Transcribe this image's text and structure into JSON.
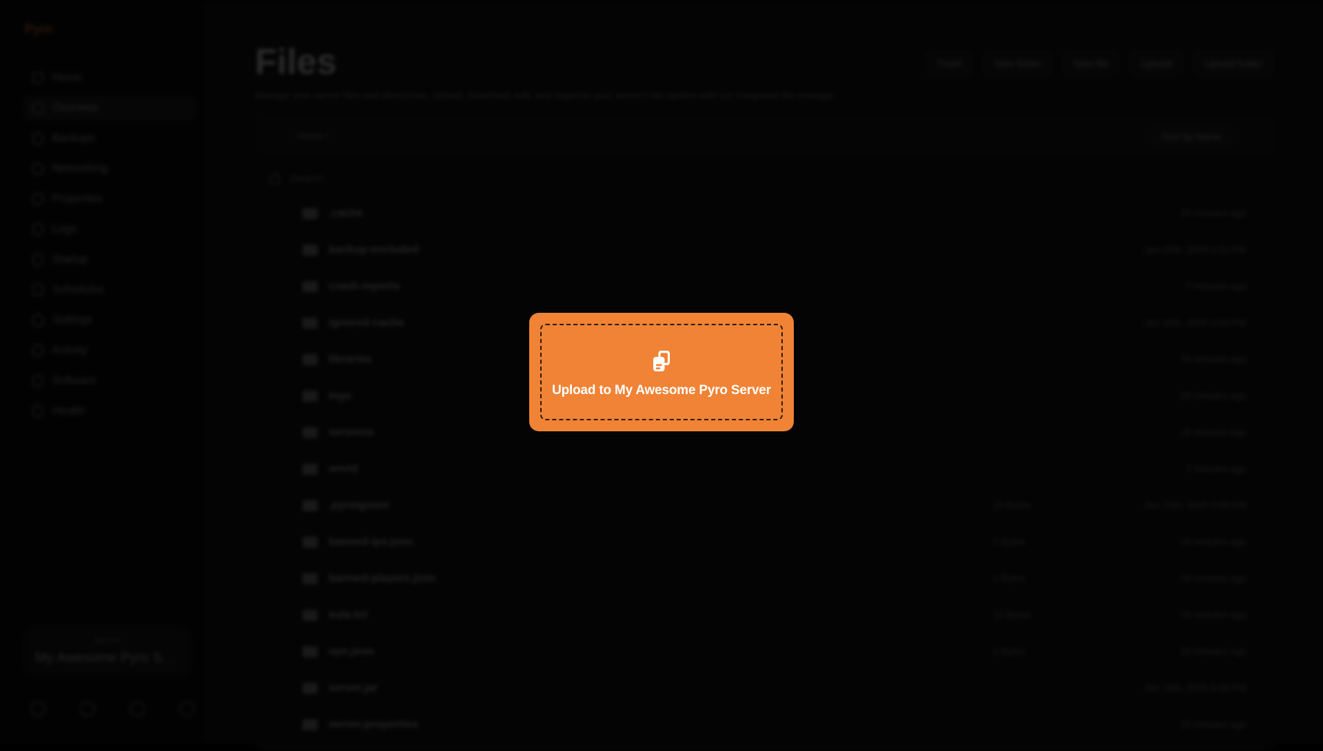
{
  "sidebar": {
    "brand": "Pyro",
    "items": [
      {
        "label": "Home"
      },
      {
        "label": "Overview"
      },
      {
        "label": "Backups"
      },
      {
        "label": "Networking"
      },
      {
        "label": "Properties"
      },
      {
        "label": "Logs"
      },
      {
        "label": "Startup"
      },
      {
        "label": "Schedules"
      },
      {
        "label": "Settings"
      },
      {
        "label": "Activity"
      },
      {
        "label": "Software"
      },
      {
        "label": "Health"
      }
    ],
    "server_card": {
      "label": "Server",
      "name": "My Awesome Pyro Se..."
    }
  },
  "main": {
    "title": "Files",
    "subtitle": "Manage your server files and directories. Upload, download, edit, and organize your server's file system with our integrated file manager.",
    "actions": [
      "Trash",
      "New folder",
      "New file",
      "Upload",
      "Upload folder"
    ],
    "breadcrumb": "Home /",
    "sort_label": "Sort by Name",
    "search_placeholder": "Search",
    "files": [
      {
        "name": ".cache",
        "type": "folder",
        "size": "",
        "date": "29 minutes ago"
      },
      {
        "name": "backup-excluded",
        "type": "folder",
        "size": "",
        "date": "Jan 15th, 2025 5:00 PM"
      },
      {
        "name": "crash-reports",
        "type": "folder",
        "size": "",
        "date": "7 minutes ago"
      },
      {
        "name": "ignored-cache",
        "type": "folder",
        "size": "",
        "date": "Jan 15th, 2025 5:00 PM"
      },
      {
        "name": "libraries",
        "type": "folder",
        "size": "",
        "date": "29 minutes ago"
      },
      {
        "name": "logs",
        "type": "folder",
        "size": "",
        "date": "29 minutes ago"
      },
      {
        "name": "versions",
        "type": "folder",
        "size": "",
        "date": "29 minutes ago"
      },
      {
        "name": "world",
        "type": "folder",
        "size": "",
        "date": "7 minutes ago"
      },
      {
        "name": ".pyroignore",
        "type": "file",
        "size": "15 Bytes",
        "date": "Jan 15th, 2025 5:00 PM"
      },
      {
        "name": "banned-ips.json",
        "type": "json",
        "size": "2 Bytes",
        "date": "29 minutes ago"
      },
      {
        "name": "banned-players.json",
        "type": "json",
        "size": "2 Bytes",
        "date": "29 minutes ago"
      },
      {
        "name": "eula.txt",
        "type": "file",
        "size": "10 Bytes",
        "date": "29 minutes ago"
      },
      {
        "name": "ops.json",
        "type": "json",
        "size": "2 Bytes",
        "date": "29 minutes ago"
      },
      {
        "name": "server.jar",
        "type": "file",
        "size": "",
        "date": "Jan 15th, 2025 5:00 PM"
      },
      {
        "name": "server.properties",
        "type": "file",
        "size": "",
        "date": "29 minutes ago"
      }
    ]
  },
  "upload_overlay": {
    "label": "Upload to My Awesome Pyro Server",
    "icon": "files-copy-icon",
    "color": "#f08335"
  }
}
